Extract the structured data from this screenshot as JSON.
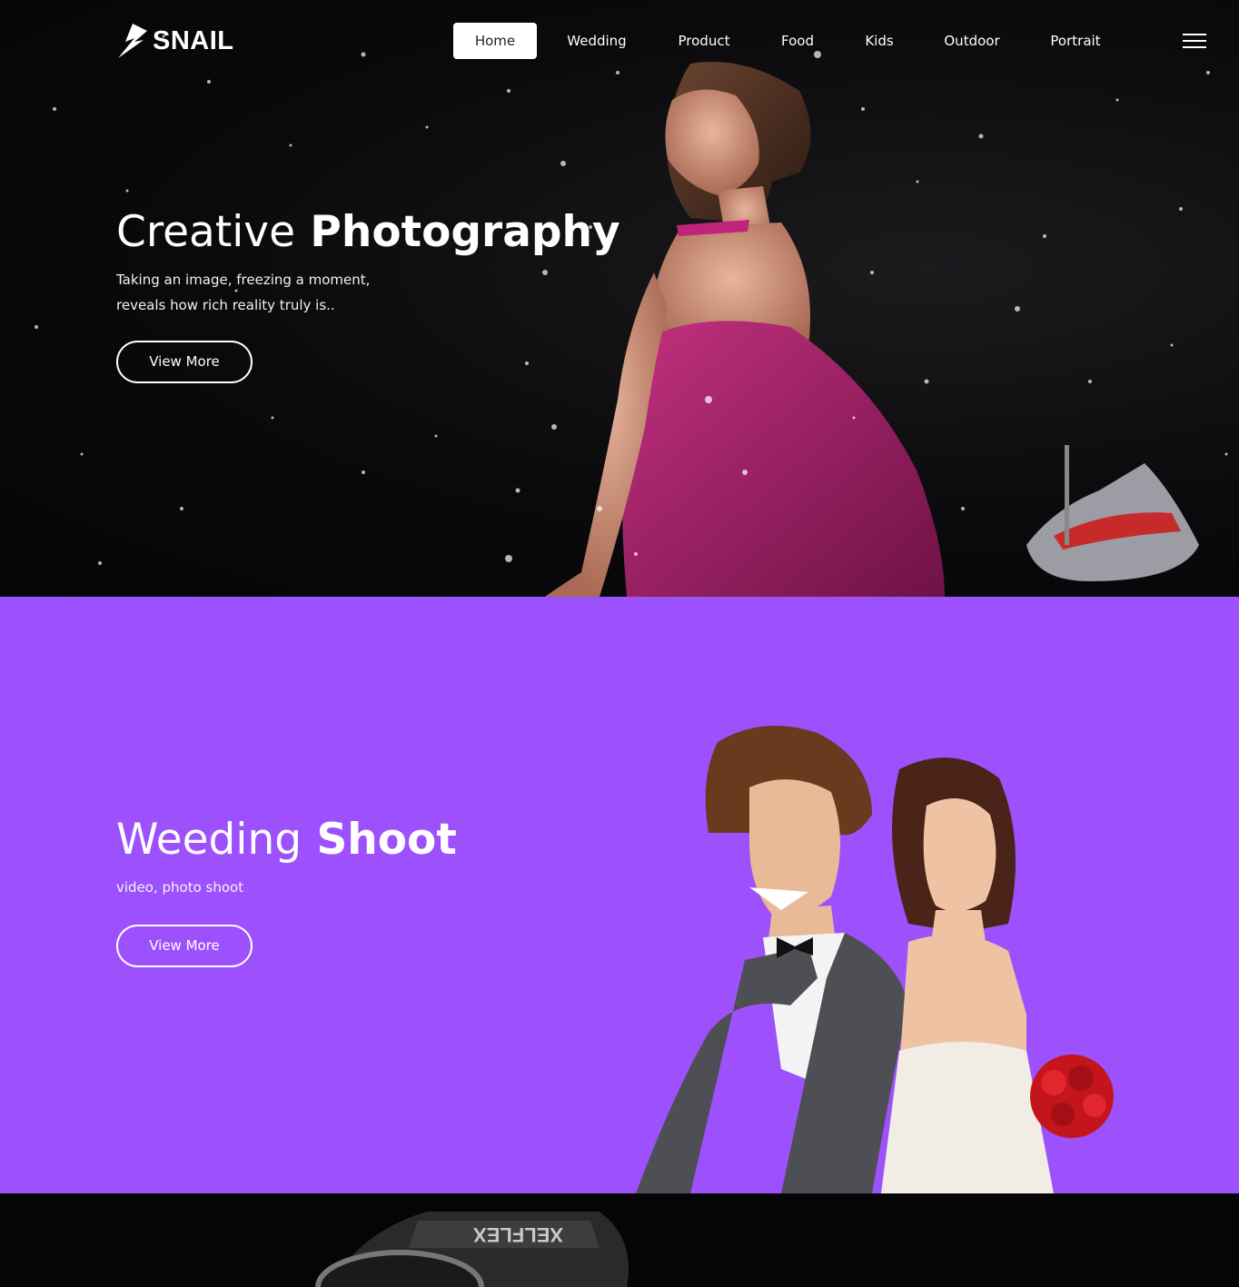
{
  "header": {
    "logo_text": "SNAIL",
    "nav": [
      {
        "label": "Home",
        "active": true
      },
      {
        "label": "Wedding",
        "active": false
      },
      {
        "label": "Product",
        "active": false
      },
      {
        "label": "Food",
        "active": false
      },
      {
        "label": "Kids",
        "active": false
      },
      {
        "label": "Outdoor",
        "active": false
      },
      {
        "label": "Portrait",
        "active": false
      }
    ],
    "menu_icon": "hamburger-icon"
  },
  "hero": {
    "title_light": "Creative",
    "title_bold": "Photography",
    "description_line1": "Taking an image, freezing a moment,",
    "description_line2": "reveals how rich reality truly is..",
    "button_label": "View More"
  },
  "wedding": {
    "title_light": "Weeding",
    "title_bold": "Shoot",
    "description": "video, photo shoot",
    "button_label": "View More",
    "background_color": "#9d51fc"
  },
  "product_preview": {
    "camera_label": "XELFLEX"
  }
}
